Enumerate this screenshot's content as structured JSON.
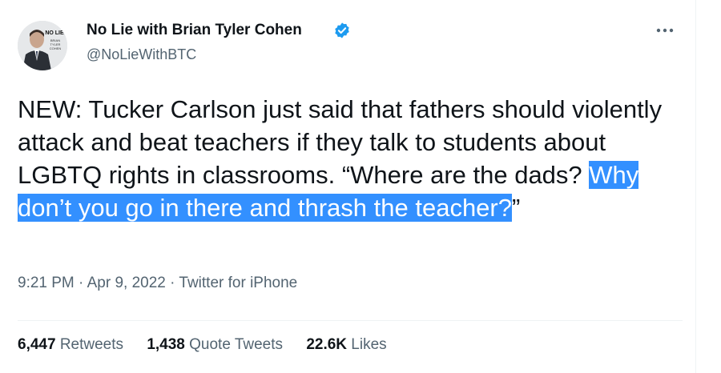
{
  "author": {
    "display_name": "No Lie with Brian Tyler Cohen",
    "handle": "@NoLieWithBTC",
    "avatar_label_top": "NO LIE",
    "avatar_label_bottom": "BRIAN TYLER COHEN",
    "verified": true
  },
  "tweet": {
    "text_plain": "NEW: Tucker Carlson just said that fathers should violently attack and beat teachers if they talk to students about LGBTQ rights in classrooms. “Where are the dads? ",
    "text_highlighted": "Why don’t you go in there and thrash the teacher?",
    "text_tail": "”"
  },
  "meta": {
    "time": "9:21 PM",
    "separator": "·",
    "date": "Apr 9, 2022",
    "source": "Twitter for iPhone"
  },
  "stats": {
    "retweets_count": "6,447",
    "retweets_label": "Retweets",
    "quotes_count": "1,438",
    "quotes_label": "Quote Tweets",
    "likes_count": "22.6K",
    "likes_label": "Likes"
  },
  "colors": {
    "highlight": "#3390ff",
    "verified_badge": "#1d9bf0",
    "secondary_text": "#536471"
  },
  "icons": {
    "verified": "verified-badge-icon",
    "more": "more-dots-icon"
  }
}
